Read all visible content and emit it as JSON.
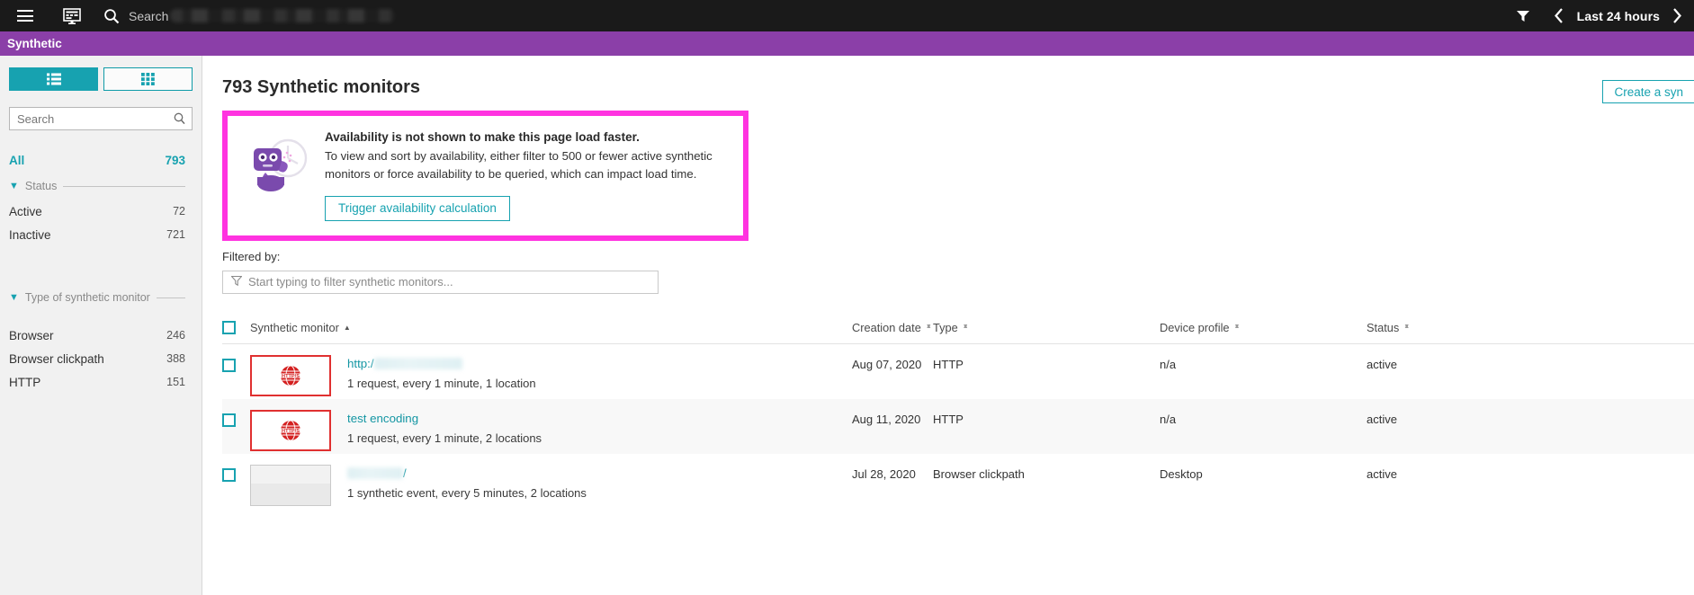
{
  "topbar": {
    "menu_icon": "hamburger-menu-icon",
    "monitor_icon": "monitor-icon",
    "search_icon": "search-icon",
    "search_placeholder": "Search",
    "filter_icon": "funnel-filter-icon",
    "prev_icon": "chevron-left-icon",
    "next_icon": "chevron-right-icon",
    "timerange": "Last 24 hours"
  },
  "subheader": {
    "title": "Synthetic"
  },
  "sidebar": {
    "view_toggle": {
      "list_label": "list-view-icon",
      "grid_label": "grid-view-icon"
    },
    "search_placeholder": "Search",
    "all": {
      "label": "All",
      "count": "793"
    },
    "groups": [
      {
        "title": "Status",
        "items": [
          {
            "label": "Active",
            "count": "72"
          },
          {
            "label": "Inactive",
            "count": "721"
          }
        ]
      },
      {
        "title": "Type of synthetic monitor",
        "items": [
          {
            "label": "Browser",
            "count": "246"
          },
          {
            "label": "Browser clickpath",
            "count": "388"
          },
          {
            "label": "HTTP",
            "count": "151"
          }
        ]
      }
    ]
  },
  "main": {
    "page_title": "793 Synthetic monitors",
    "create_button": "Create a syn",
    "banner": {
      "title": "Availability is not shown to make this page load faster.",
      "body": "To view and sort by availability, either filter to 500 or fewer active synthetic monitors or force availability to be queried, which can impact load time.",
      "button": "Trigger availability calculation",
      "border_color": "#ff33e0"
    },
    "filtered_label": "Filtered by:",
    "filter_placeholder": "Start typing to filter synthetic monitors...",
    "table": {
      "columns": {
        "name": "Synthetic monitor",
        "creation_date": "Creation date",
        "type": "Type",
        "device_profile": "Device profile",
        "status": "Status"
      },
      "sort_indicator": "▲",
      "rows": [
        {
          "name_prefix": "http:/",
          "name_redacted": true,
          "subtitle": "1 request, every 1 minute, 1 location",
          "creation_date": "Aug 07, 2020",
          "type": "HTTP",
          "device_profile": "n/a",
          "status": "active",
          "thumb": "https-logo"
        },
        {
          "name_prefix": "test encoding",
          "name_redacted": false,
          "subtitle": "1 request, every 1 minute, 2 locations",
          "creation_date": "Aug 11, 2020",
          "type": "HTTP",
          "device_profile": "n/a",
          "status": "active",
          "thumb": "https-logo"
        },
        {
          "name_prefix": "",
          "name_redacted": true,
          "subtitle": "1 synthetic event, every 5 minutes, 2 locations",
          "creation_date": "Jul 28, 2020",
          "type": "Browser clickpath",
          "device_profile": "Desktop",
          "status": "active",
          "thumb": "page-screenshot"
        }
      ]
    }
  },
  "colors": {
    "accent_teal": "#17a2b0",
    "purple": "#8b3fa8",
    "magenta": "#ff33e0",
    "red": "#e03030"
  }
}
